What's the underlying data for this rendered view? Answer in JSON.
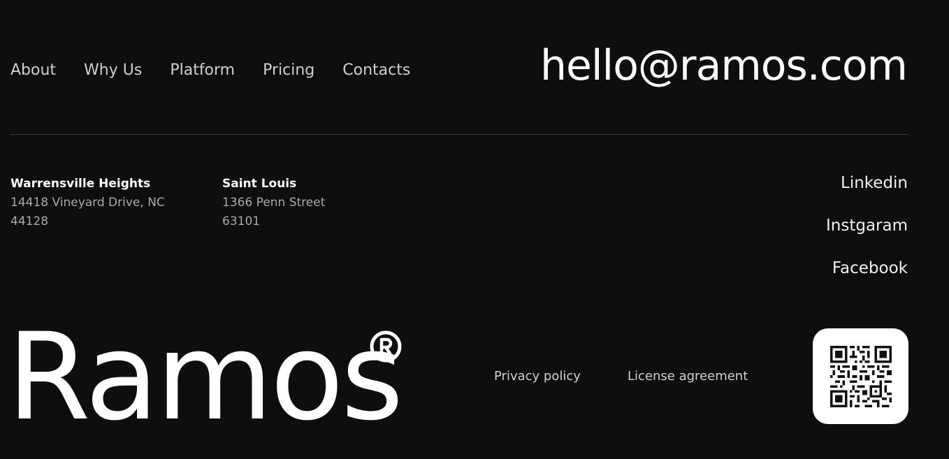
{
  "nav": {
    "items": [
      {
        "label": "About"
      },
      {
        "label": "Why Us"
      },
      {
        "label": "Platform"
      },
      {
        "label": "Pricing"
      },
      {
        "label": "Contacts"
      }
    ]
  },
  "contact": {
    "email": "hello@ramos.com"
  },
  "addresses": [
    {
      "city": "Warrensville Heights",
      "street": "14418 Vineyard Drive, NC",
      "zip": "44128"
    },
    {
      "city": "Saint Louis",
      "street": "1366 Penn Street",
      "zip": "63101"
    }
  ],
  "social": {
    "links": [
      {
        "label": "Linkedin"
      },
      {
        "label": "Instgaram"
      },
      {
        "label": "Facebook"
      }
    ]
  },
  "brand": {
    "name": "Ramos",
    "mark_icon": "registered-trademark-icon"
  },
  "legal": {
    "privacy": "Privacy policy",
    "license": "License agreement"
  },
  "qr": {
    "icon": "qr-code-icon"
  },
  "colors": {
    "background": "#0e0e0e",
    "text": "#ffffff",
    "muted": "#a9a9a9",
    "divider": "#3a3a3a"
  }
}
